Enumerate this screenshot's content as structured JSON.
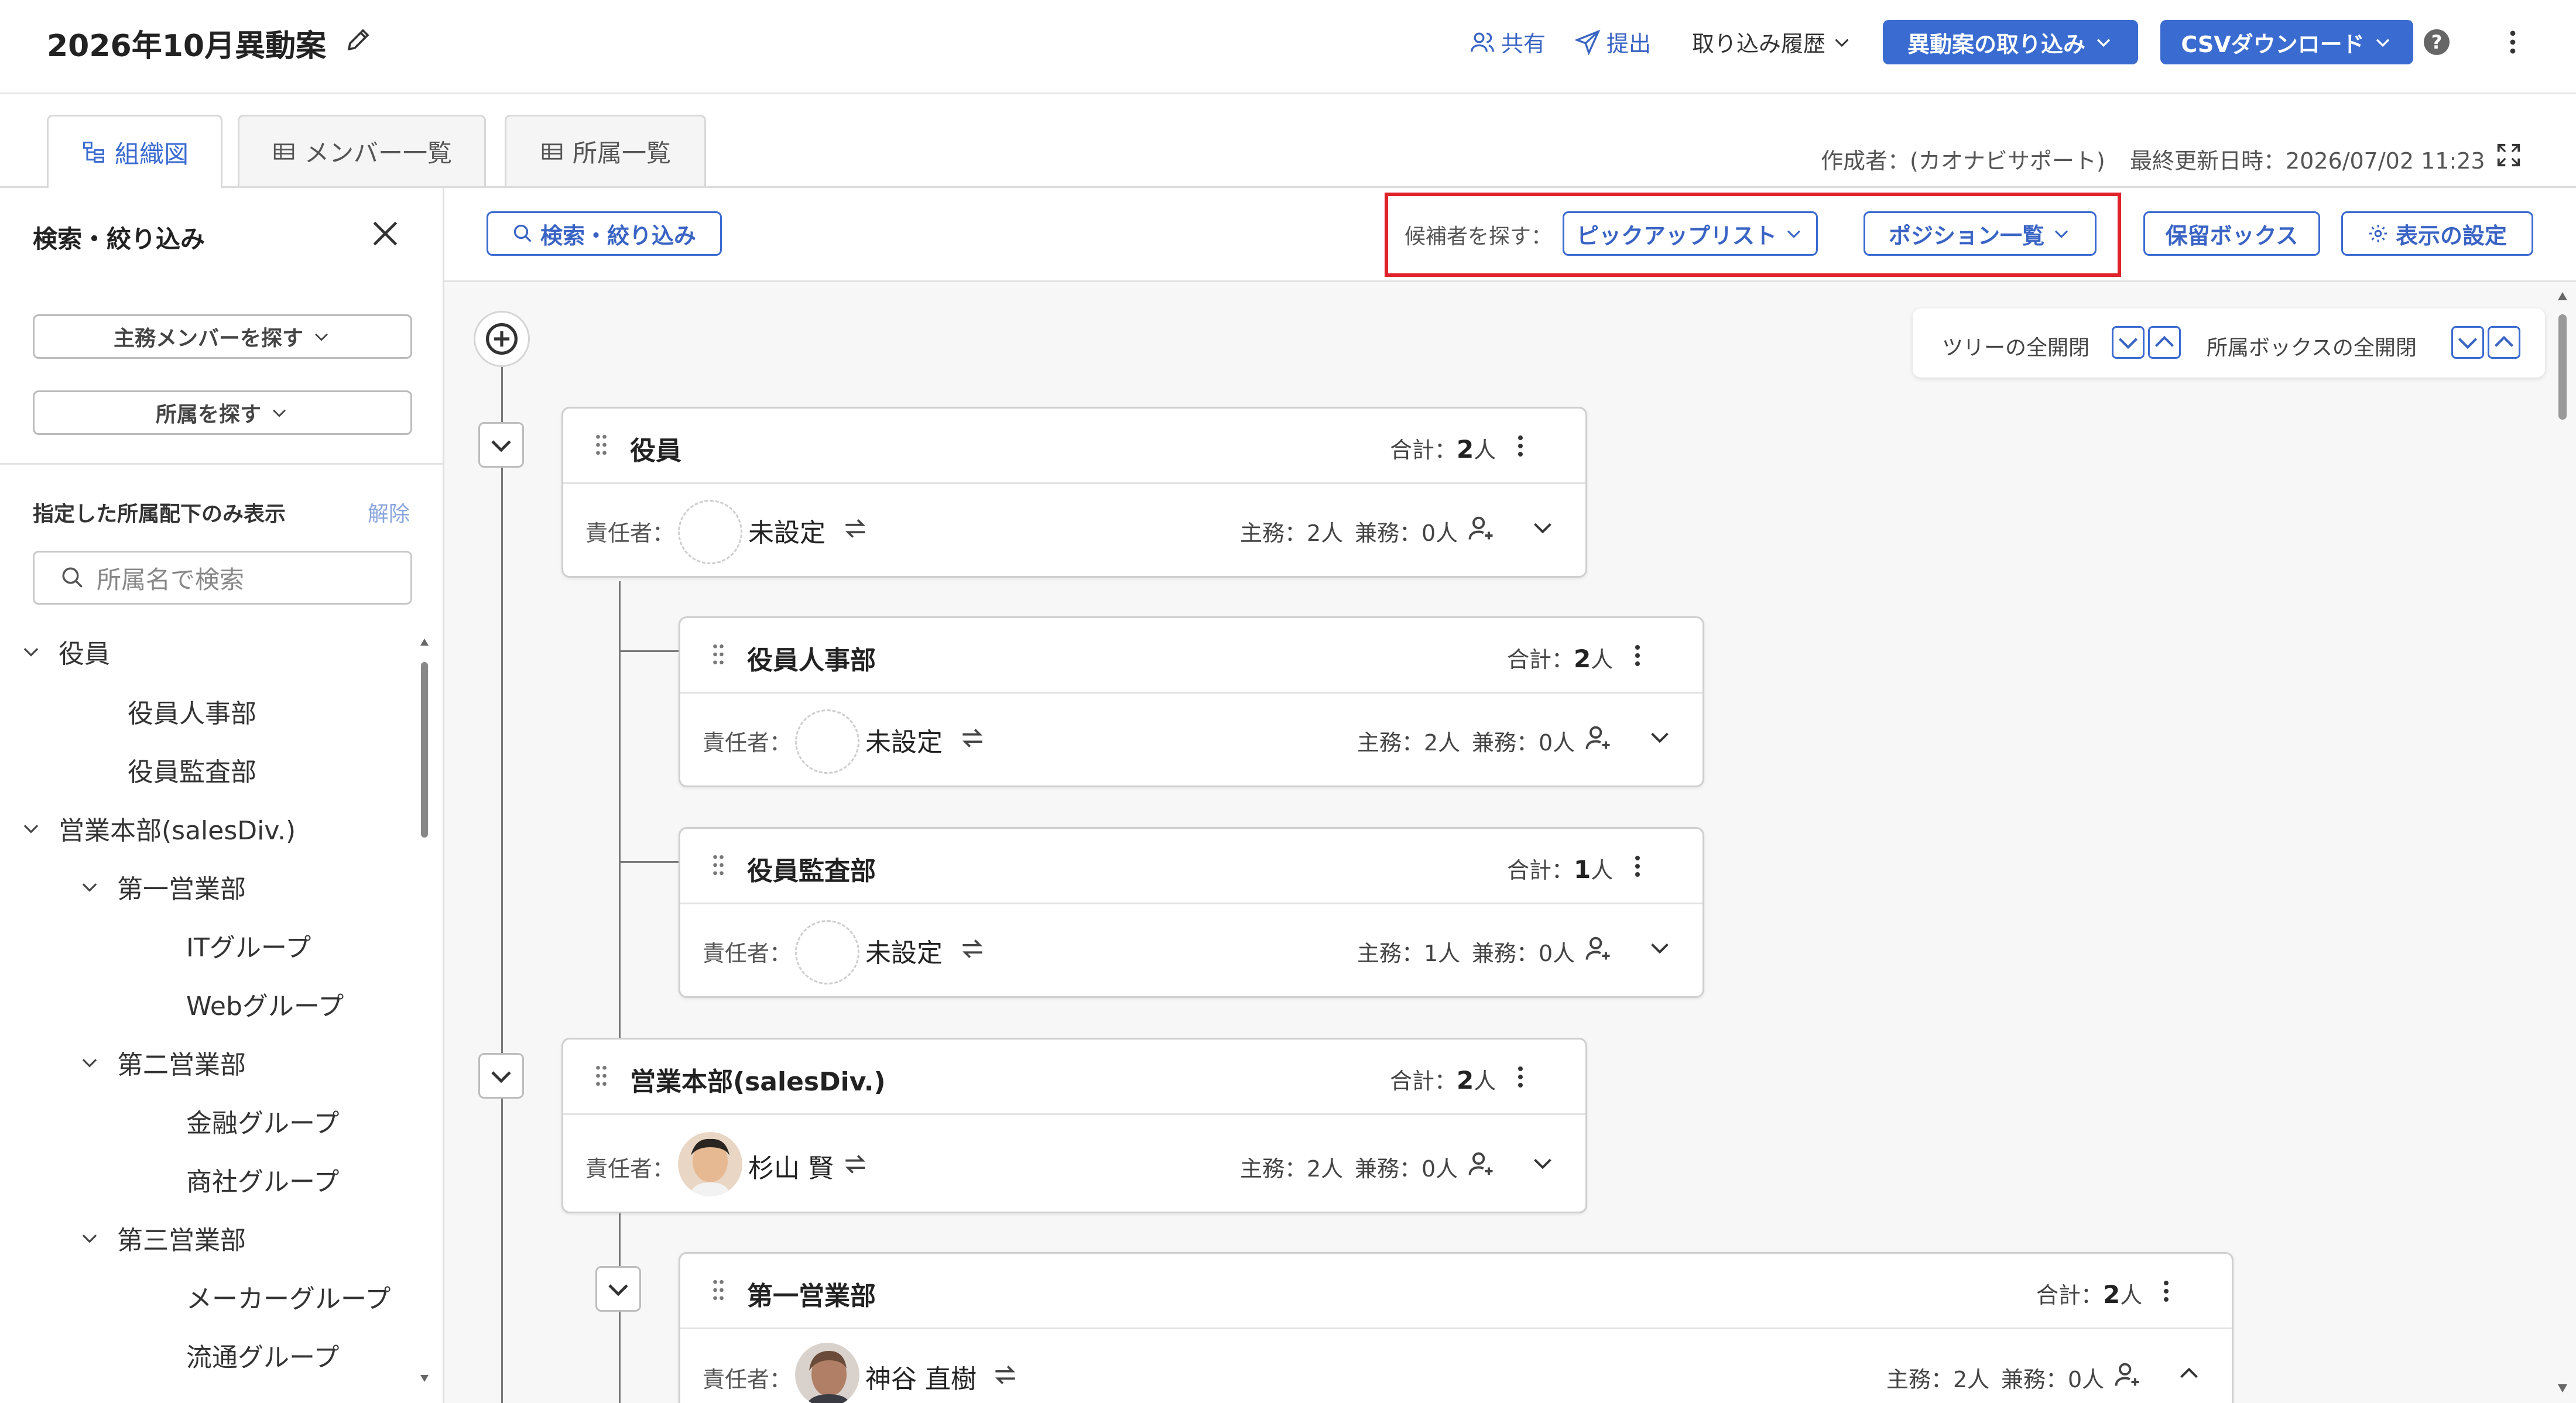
{
  "header": {
    "title": "2026年10月異動案",
    "share_label": "共有",
    "submit_label": "提出",
    "import_history_label": "取り込み履歴",
    "import_button_label": "異動案の取り込み",
    "csv_button_label": "CSVダウンロード",
    "help_symbol": "?"
  },
  "tabs": [
    {
      "label": "組織図",
      "active": true
    },
    {
      "label": "メンバー一覧",
      "active": false
    },
    {
      "label": "所属一覧",
      "active": false
    }
  ],
  "meta": {
    "author": "作成者：(カオナビサポート)",
    "updated": "最終更新日時：2026/07/02 11:23"
  },
  "sidebar": {
    "title": "検索・絞り込み",
    "find_member_label": "主務メンバーを探す",
    "find_dept_label": "所属を探す",
    "filter_label": "指定した所属配下のみ表示",
    "clear_label": "解除",
    "search_placeholder": "所属名で検索",
    "tree": [
      {
        "label": "役員",
        "expanded": true
      },
      {
        "label": "役員人事部"
      },
      {
        "label": "役員監査部"
      },
      {
        "label": "営業本部(salesDiv.)",
        "expanded": true
      },
      {
        "label": "第一営業部",
        "expanded": true
      },
      {
        "label": "ITグループ"
      },
      {
        "label": "Webグループ"
      },
      {
        "label": "第二営業部",
        "expanded": true
      },
      {
        "label": "金融グループ"
      },
      {
        "label": "商社グループ"
      },
      {
        "label": "第三営業部",
        "expanded": true
      },
      {
        "label": "メーカーグループ"
      },
      {
        "label": "流通グループ"
      }
    ]
  },
  "toolbar": {
    "search_filter_label": "検索・絞り込み",
    "candidate_label": "候補者を探す：",
    "pickup_list_label": "ピックアップリスト",
    "position_list_label": "ポジション一覧",
    "hold_box_label": "保留ボックス",
    "display_settings_label": "表示の設定"
  },
  "expand_controls": {
    "tree_label": "ツリーの全開閉",
    "box_label": "所属ボックスの全開閉"
  },
  "cards": [
    {
      "name": "役員",
      "total_label": "合計：",
      "total": "2",
      "unit": "人",
      "resp_label": "責任者：",
      "resp_name": "未設定",
      "main_count": "主務：2人",
      "sub_count": "兼務：0人"
    },
    {
      "name": "役員人事部",
      "total_label": "合計：",
      "total": "2",
      "unit": "人",
      "resp_label": "責任者：",
      "resp_name": "未設定",
      "main_count": "主務：2人",
      "sub_count": "兼務：0人"
    },
    {
      "name": "役員監査部",
      "total_label": "合計：",
      "total": "1",
      "unit": "人",
      "resp_label": "責任者：",
      "resp_name": "未設定",
      "main_count": "主務：1人",
      "sub_count": "兼務：0人"
    },
    {
      "name": "営業本部(salesDiv.)",
      "total_label": "合計：",
      "total": "2",
      "unit": "人",
      "resp_label": "責任者：",
      "resp_name": "杉山 賢",
      "main_count": "主務：2人",
      "sub_count": "兼務：0人"
    },
    {
      "name": "第一営業部",
      "total_label": "合計：",
      "total": "2",
      "unit": "人",
      "resp_label": "責任者：",
      "resp_name": "神谷 直樹",
      "main_count": "主務：2人",
      "sub_count": "兼務：0人"
    }
  ],
  "colors": {
    "accent": "#3a6bd0",
    "highlight": "#e0222b"
  }
}
